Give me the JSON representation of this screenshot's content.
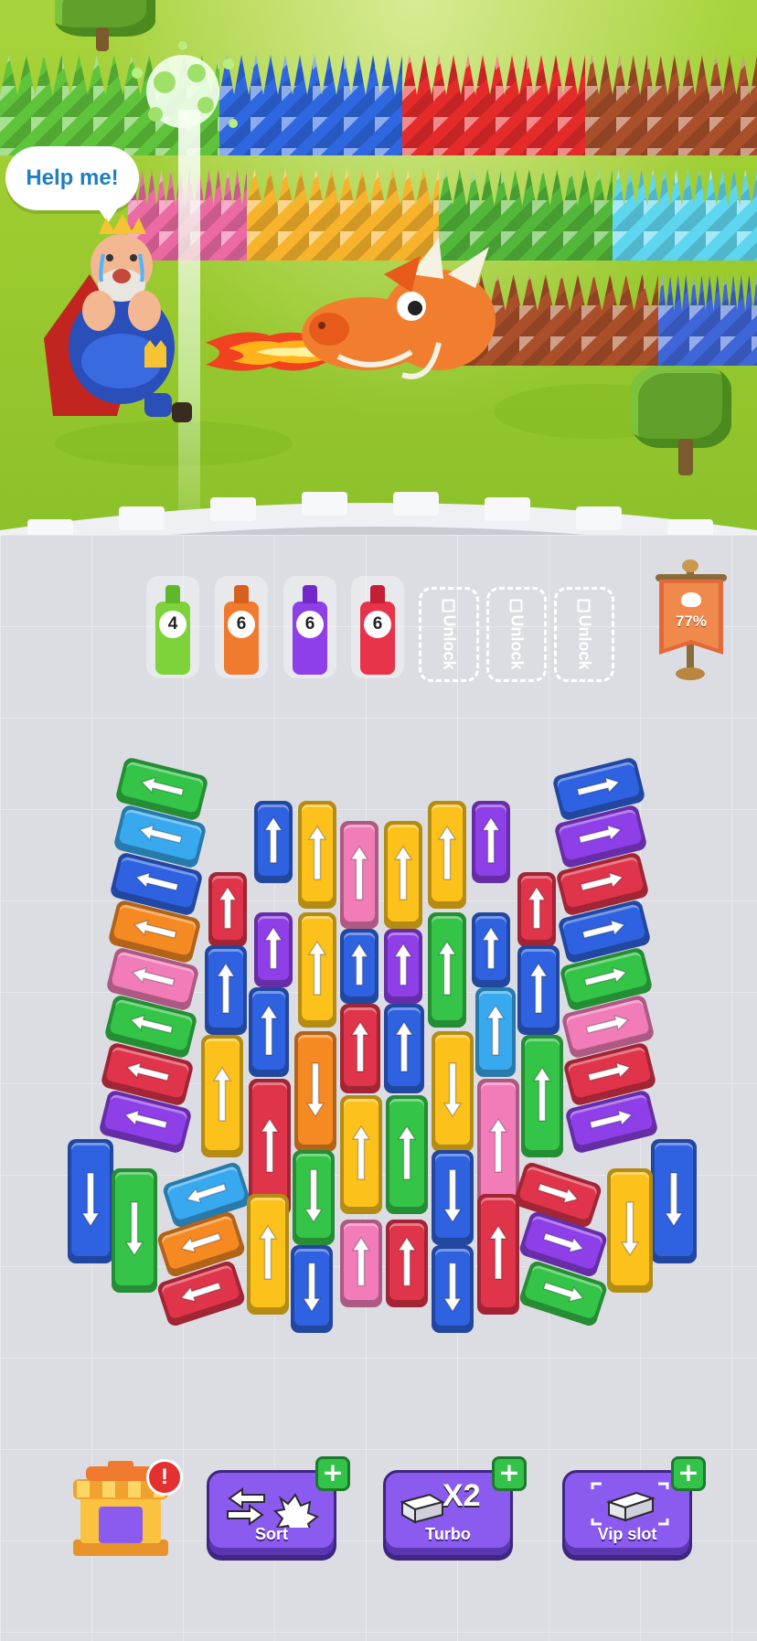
{
  "scene": {
    "speech_bubble": "Help me!",
    "characters": [
      "king",
      "dragon"
    ]
  },
  "bottles": [
    {
      "count": "4",
      "color": "#7ed33b"
    },
    {
      "count": "6",
      "color": "#f07a2e"
    },
    {
      "count": "6",
      "color": "#8e3fe8"
    },
    {
      "count": "6",
      "color": "#e8344a"
    }
  ],
  "locked_slots": [
    "Unlock",
    "Unlock",
    "Unlock"
  ],
  "progress": {
    "label": "77%",
    "value": 0.77
  },
  "toolbar": {
    "shop_badge": "!",
    "sort_label": "Sort",
    "turbo_label": "Turbo",
    "turbo_icon_text": "X2",
    "vip_label": "Vip slot",
    "plus": "+"
  },
  "colors": {
    "red": "#e0344a",
    "blue": "#2f62e0",
    "green": "#34c448",
    "yellow": "#fcc21b",
    "pink": "#f27cb8",
    "purple": "#8e3fe8",
    "orange": "#f58a23",
    "cyan": "#39a9ef",
    "toolbar_purple": "#8b5bf0",
    "plus_green": "#33c24a"
  }
}
